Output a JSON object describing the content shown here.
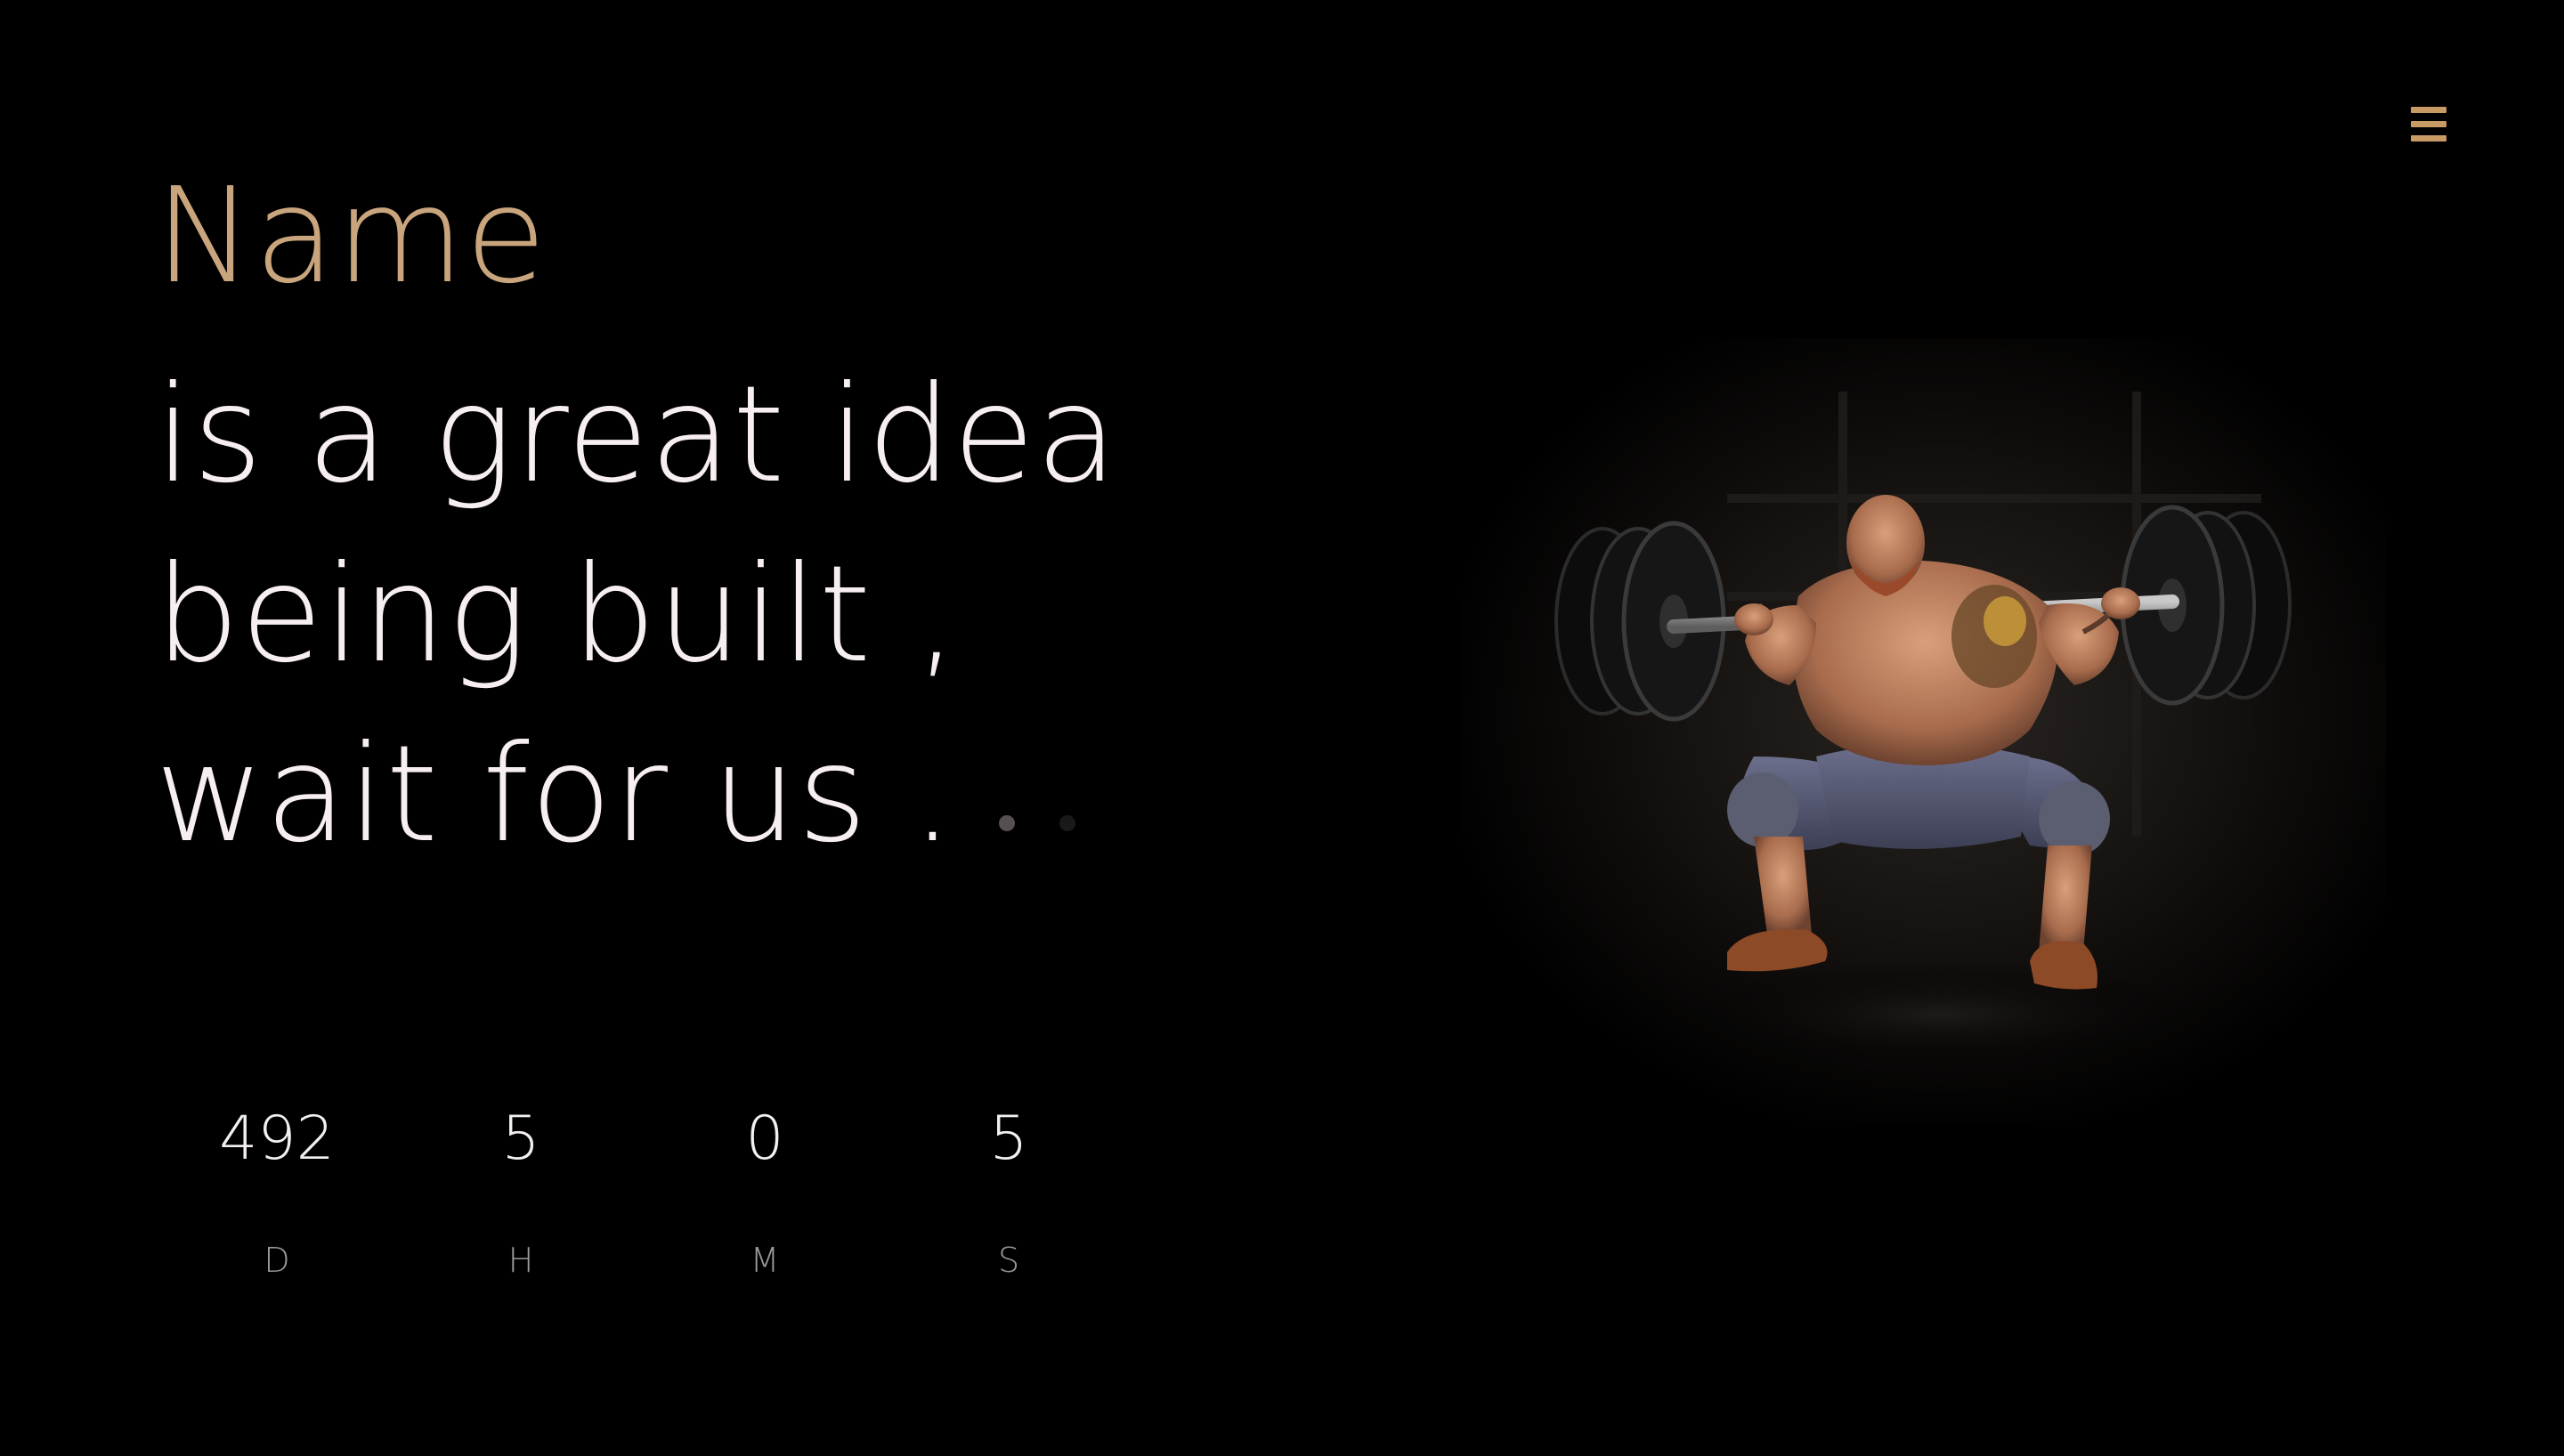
{
  "header": {
    "menu_icon": "hamburger-menu-icon",
    "accent_color": "#c89a64"
  },
  "hero": {
    "brand": "Name",
    "line1": "is a great idea",
    "line2": "being built ,",
    "line3": "wait for us .",
    "brand_color": "#c8a57d",
    "text_color": "#f7eef0"
  },
  "countdown": {
    "days": {
      "value": "492",
      "label": "D"
    },
    "hours": {
      "value": "5",
      "label": "H"
    },
    "minutes": {
      "value": "0",
      "label": "M"
    },
    "seconds": {
      "value": "5",
      "label": "S"
    }
  },
  "image": {
    "subject": "weightlifter-squat-image"
  }
}
